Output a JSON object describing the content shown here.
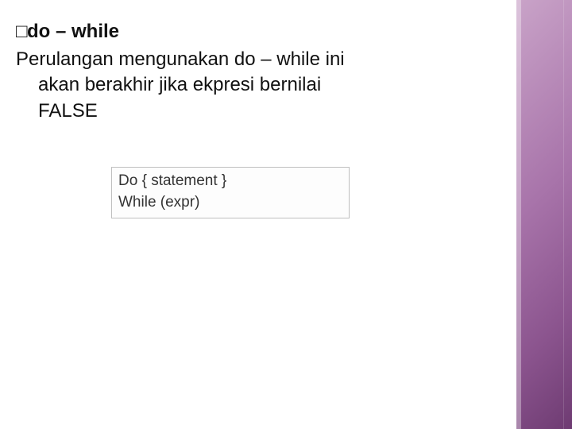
{
  "heading": {
    "bullet": "□",
    "bold_prefix": "do",
    "rest": " – while"
  },
  "body": {
    "line1": "Perulangan mengunakan do – while ini",
    "line2": "akan berakhir jika ekpresi bernilai",
    "line3": "FALSE"
  },
  "code": {
    "line1": "Do { statement }",
    "line2": "While (expr)"
  }
}
